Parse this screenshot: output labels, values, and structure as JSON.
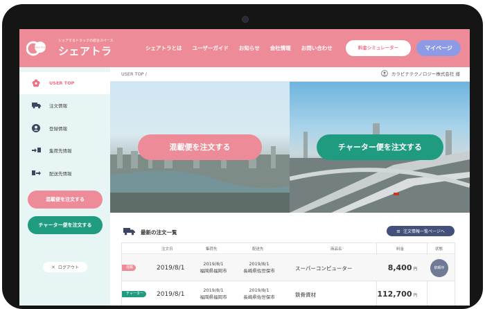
{
  "header": {
    "tagline": "シェアするトラックの総合スペース",
    "logo_text": "シェアトラ",
    "logo_badge": "Share Truck",
    "nav": [
      "シェアトラとは",
      "ユーザーガイド",
      "お知らせ",
      "会社情報",
      "お問い合わせ"
    ],
    "simulator_label": "料金シミュレーター",
    "mypage_label": "マイページ"
  },
  "breadcrumb": "USER TOP /",
  "user": {
    "company": "カラビナテクノロジー株式会社 様"
  },
  "sidebar": {
    "items": [
      {
        "label": "USER TOP",
        "icon": "flower-icon",
        "active": true
      },
      {
        "label": "注文情報",
        "icon": "truck-icon",
        "active": false
      },
      {
        "label": "登録情報",
        "icon": "user-circle-icon",
        "active": false
      },
      {
        "label": "集荷先情報",
        "icon": "pickup-icon",
        "active": false
      },
      {
        "label": "配送先情報",
        "icon": "delivery-icon",
        "active": false
      }
    ],
    "mixed_order_label": "混載便を注文する",
    "charter_order_label": "チャーター便を注文する",
    "logout_label": "ログアウト"
  },
  "hero": {
    "mixed_label": "混載便を注文する",
    "charter_label": "チャーター便を注文する"
  },
  "orders": {
    "title": "最新の注文一覧",
    "link_label": "注文情報一覧ページへ",
    "columns": [
      "注文日",
      "集荷先",
      "配送先",
      "商品名",
      "料金",
      "状態"
    ],
    "rows": [
      {
        "badge": "混載",
        "date": "2019/8/1",
        "pickup_date": "2019/8/1",
        "pickup": "福岡県福岡市",
        "delivery_date": "2019/8/1",
        "delivery": "長崎県佐世保市",
        "product": "スーパーコンピューター",
        "price": "8,400",
        "yen": "円",
        "status": "依頼中"
      },
      {
        "badge": "チャーター",
        "date": "2019/8/1",
        "pickup_date": "2019/8/1",
        "pickup": "福岡県福岡市",
        "delivery_date": "2019/8/1",
        "delivery": "長崎県佐世保市",
        "product": "鉄骨資材",
        "price": "112,700",
        "yen": "円",
        "status": ""
      }
    ]
  },
  "colors": {
    "brand_pink": "#ee8b98",
    "accent_green": "#1f9c80",
    "mypage_blue": "#8d9be6",
    "navy": "#42507a"
  }
}
